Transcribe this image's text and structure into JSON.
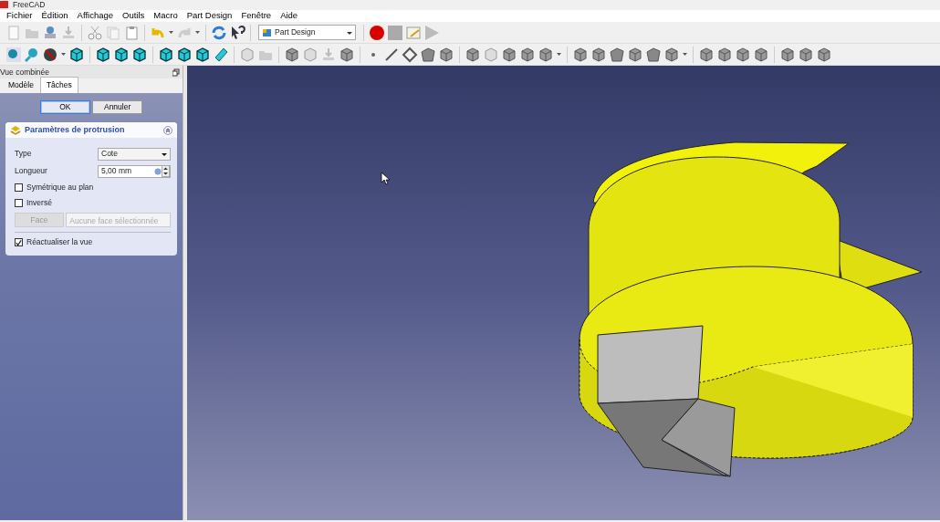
{
  "window": {
    "title": "FreeCAD"
  },
  "menu": [
    "Fichier",
    "Édition",
    "Affichage",
    "Outils",
    "Macro",
    "Part Design",
    "Fenêtre",
    "Aide"
  ],
  "toolbar": {
    "workbench": "Part Design"
  },
  "panel": {
    "title": "Vue combinée",
    "tabs": [
      {
        "label": "Modèle",
        "selected": false
      },
      {
        "label": "Tâches",
        "selected": true
      }
    ],
    "buttons": [
      {
        "label": "OK",
        "selected": true
      },
      {
        "label": "Annuler",
        "selected": false
      }
    ],
    "task": {
      "title": "Paramètres de protrusion",
      "expanded": true,
      "type_label": "Type",
      "type_value": "Cote",
      "length_label": "Longueur",
      "length_value": "5,00 mm",
      "checks": [
        {
          "label": "Symétrique au plan",
          "checked": false
        },
        {
          "label": "Inversé",
          "checked": false
        }
      ],
      "face_button": {
        "label": "Face",
        "disabled": true
      },
      "face_field": {
        "value": "Aucune face sélectionnée",
        "disabled": true
      },
      "refresh": {
        "label": "Réactualiser la vue",
        "checked": true
      }
    }
  }
}
